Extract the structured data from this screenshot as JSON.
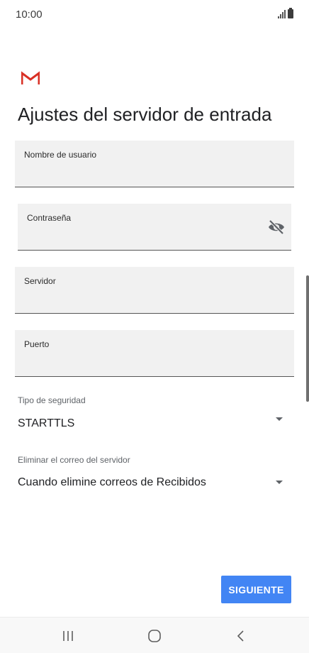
{
  "status_bar": {
    "time": "10:00",
    "signal_icon": "signal-bars-icon",
    "battery_icon": "battery-icon"
  },
  "logo": {
    "icon": "gmail-logo"
  },
  "page": {
    "title": "Ajustes del servidor de entrada"
  },
  "fields": {
    "username": {
      "label": "Nombre de usuario",
      "value": ""
    },
    "password": {
      "label": "Contraseña",
      "value": "",
      "toggle_icon": "eye-off-icon"
    },
    "server": {
      "label": "Servidor",
      "value": ""
    },
    "port": {
      "label": "Puerto",
      "value": ""
    }
  },
  "security": {
    "label": "Tipo de seguridad",
    "value": "STARTTLS"
  },
  "delete_mail": {
    "label": "Eliminar el correo del servidor",
    "value": "Cuando elimine correos de Recibidos"
  },
  "actions": {
    "next_label": "SIGUIENTE",
    "next_color": "#4285f4"
  },
  "nav_bar": {
    "recents_icon": "recents-icon",
    "home_icon": "home-icon",
    "back_icon": "back-icon"
  }
}
